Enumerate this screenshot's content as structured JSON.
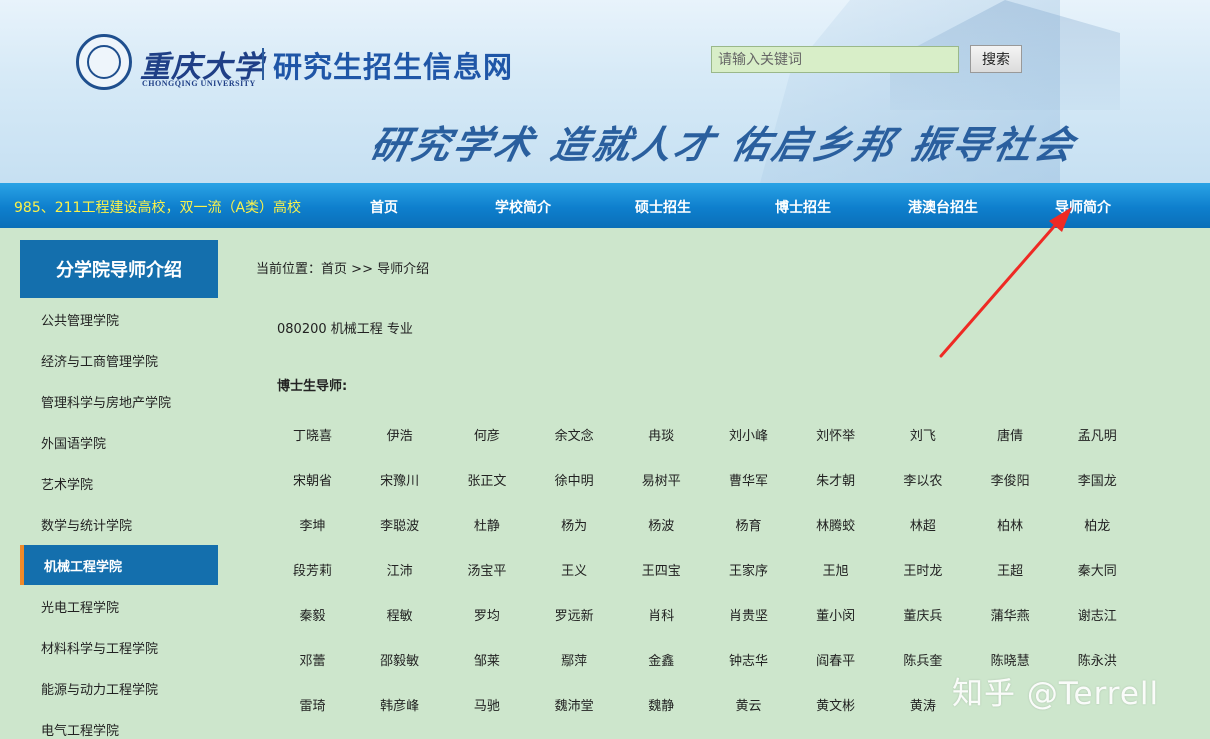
{
  "header": {
    "logo_cn": "重庆大学",
    "logo_en": "CHONGQING UNIVERSITY",
    "site_title": "研究生招生信息网",
    "search_placeholder": "请输入关键词",
    "search_button": "搜索",
    "slogan": "研究学术 造就人才 佑启乡邦 振导社会"
  },
  "nav": {
    "tagline": "985、211工程建设高校，双一流（A类）高校",
    "items": [
      "首页",
      "学校简介",
      "硕士招生",
      "博士招生",
      "港澳台招生",
      "导师简介"
    ]
  },
  "sidebar": {
    "title": "分学院导师介绍",
    "items": [
      "公共管理学院",
      "经济与工商管理学院",
      "管理科学与房地产学院",
      "外国语学院",
      "艺术学院",
      "数学与统计学院",
      "机械工程学院",
      "光电工程学院",
      "材料科学与工程学院",
      "能源与动力工程学院",
      "电气工程学院"
    ],
    "active_index": 6
  },
  "main": {
    "breadcrumb": {
      "prefix": "当前位置：",
      "home": "首页",
      "separator": ">>",
      "current": "导师介绍"
    },
    "major": "080200 机械工程 专业",
    "section_title": "博士生导师:",
    "advisors": [
      [
        "丁晓喜",
        "伊浩",
        "何彦",
        "余文念",
        "冉琰",
        "刘小峰",
        "刘怀举",
        "刘飞",
        "唐倩",
        "孟凡明"
      ],
      [
        "宋朝省",
        "宋豫川",
        "张正文",
        "徐中明",
        "易树平",
        "曹华军",
        "朱才朝",
        "李以农",
        "李俊阳",
        "李国龙"
      ],
      [
        "李坤",
        "李聪波",
        "杜静",
        "杨为",
        "杨波",
        "杨育",
        "林腾蛟",
        "林超",
        "柏林",
        "柏龙"
      ],
      [
        "段芳莉",
        "江沛",
        "汤宝平",
        "王义",
        "王四宝",
        "王家序",
        "王旭",
        "王时龙",
        "王超",
        "秦大同"
      ],
      [
        "秦毅",
        "程敏",
        "罗均",
        "罗远新",
        "肖科",
        "肖贵坚",
        "董小闵",
        "董庆兵",
        "蒲华燕",
        "谢志江"
      ],
      [
        "邓蕾",
        "邵毅敏",
        "邹莱",
        "鄢萍",
        "金鑫",
        "钟志华",
        "阎春平",
        "陈兵奎",
        "陈晓慧",
        "陈永洪"
      ],
      [
        "雷琦",
        "韩彦峰",
        "马驰",
        "魏沛堂",
        "魏静",
        "黄云",
        "黄文彬",
        "黄涛",
        "",
        ""
      ]
    ]
  },
  "annotation": {
    "arrow_color": "#ee2a24"
  },
  "watermark": "知乎 @Terrell"
}
